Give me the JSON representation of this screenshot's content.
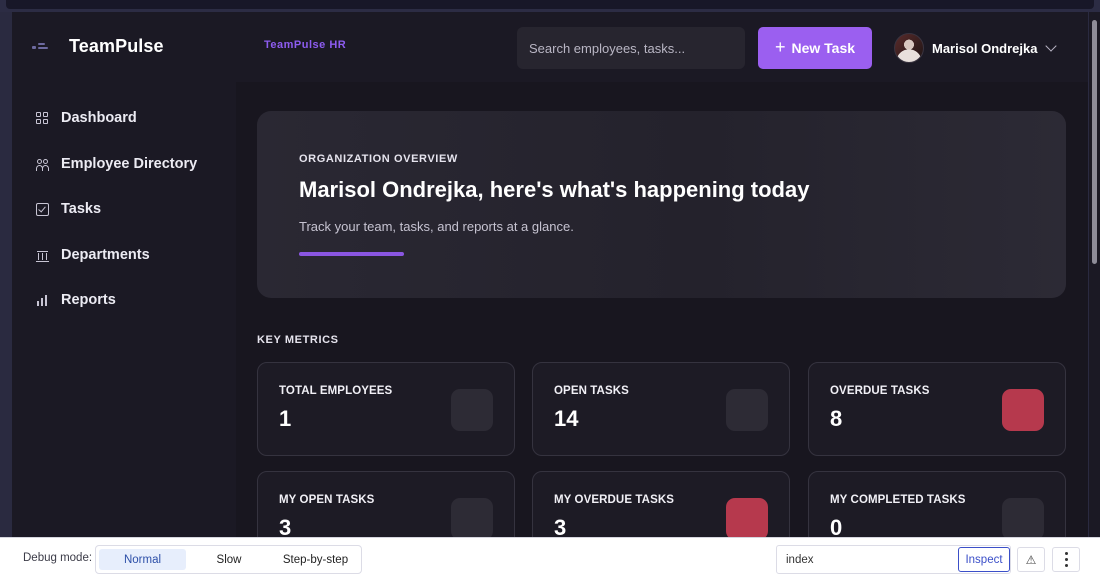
{
  "header": {
    "brand": "TeamPulse",
    "subbrand": "TeamPulse HR",
    "search_placeholder": "Search employees, tasks...",
    "new_task_label": "New Task",
    "user_name": "Marisol Ondrejka"
  },
  "sidebar": {
    "items": [
      {
        "label": "Dashboard",
        "icon": "grid-icon"
      },
      {
        "label": "Employee Directory",
        "icon": "users-icon"
      },
      {
        "label": "Tasks",
        "icon": "checkbox-icon"
      },
      {
        "label": "Departments",
        "icon": "building-icon"
      },
      {
        "label": "Reports",
        "icon": "bar-chart-icon"
      }
    ]
  },
  "hero": {
    "kicker": "ORGANIZATION OVERVIEW",
    "title": "Marisol Ondrejka, here's what's happening today",
    "subtitle": "Track your team, tasks, and reports at a glance."
  },
  "metrics": {
    "section_label": "KEY METRICS",
    "cards": [
      {
        "title": "TOTAL EMPLOYEES",
        "value": "1",
        "alert": false
      },
      {
        "title": "OPEN TASKS",
        "value": "14",
        "alert": false
      },
      {
        "title": "OVERDUE TASKS",
        "value": "8",
        "alert": true
      },
      {
        "title": "MY OPEN TASKS",
        "value": "3",
        "alert": false
      },
      {
        "title": "MY OVERDUE TASKS",
        "value": "3",
        "alert": true
      },
      {
        "title": "MY COMPLETED TASKS",
        "value": "0",
        "alert": false
      }
    ]
  },
  "debug": {
    "label": "Debug mode:",
    "modes": [
      "Normal",
      "Slow",
      "Step-by-step"
    ],
    "active_mode": "Normal",
    "route_value": "index",
    "inspect_label": "Inspect"
  },
  "colors": {
    "accent": "#9b5ff0",
    "alert": "#b6394d",
    "background": "#18161f"
  }
}
